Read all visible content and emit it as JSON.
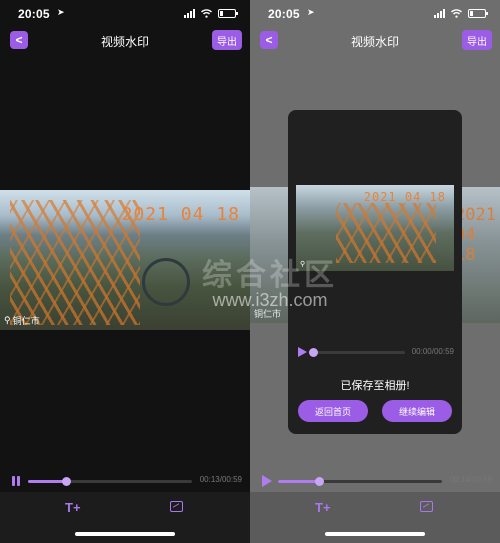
{
  "status_bar": {
    "time": "20:05",
    "location_glyph": "➤"
  },
  "navbar": {
    "back_glyph": "<",
    "title": "视频水印",
    "export_label": "导出"
  },
  "video": {
    "watermark_date": "2021 04 18",
    "watermark_location": "铜仁市"
  },
  "site_watermark": {
    "mark": "综合社区",
    "url": "www.i3zh.com"
  },
  "player_left": {
    "time": "00:13/00:59",
    "progress": 0.23
  },
  "player_right": {
    "time": "00:14/00:59",
    "progress": 0.25
  },
  "dialog": {
    "time": "00:00/00:59",
    "progress": 0.0,
    "message": "已保存至相册!",
    "home_button": "返回首页",
    "continue_button": "继续编辑",
    "video_date": "2021 04 18",
    "video_location": "铜仁市"
  },
  "toolbar": {
    "text_tool_glyph": "T+",
    "icons": [
      "text-add-icon",
      "image-icon"
    ]
  },
  "colors": {
    "accent": "#9b5de5",
    "watermark_orange": "#e8843a"
  }
}
